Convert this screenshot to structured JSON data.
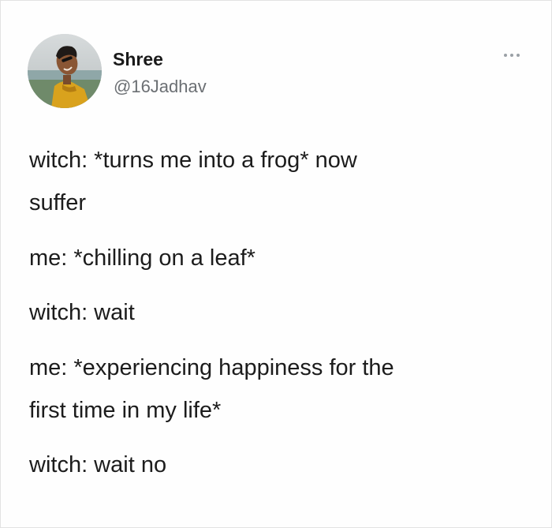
{
  "author": {
    "display_name": "Shree",
    "handle": "@16Jadhav",
    "avatar_icon": "profile-photo"
  },
  "more_icon": "more-horizontal-icon",
  "tweet_lines": [
    "witch: *turns me into a frog* now",
    "suffer",
    "me: *chilling on a leaf*",
    "witch: wait",
    "me: *experiencing happiness for the",
    "first time in my life*",
    "witch: wait no"
  ],
  "colors": {
    "text": "#1c1c1c",
    "handle": "#6b6f73",
    "background": "#fefefe"
  }
}
